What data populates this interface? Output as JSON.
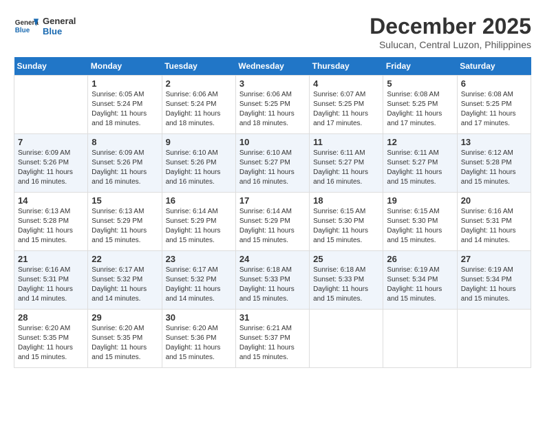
{
  "logo": {
    "text_general": "General",
    "text_blue": "Blue"
  },
  "title": "December 2025",
  "location": "Sulucan, Central Luzon, Philippines",
  "days_of_week": [
    "Sunday",
    "Monday",
    "Tuesday",
    "Wednesday",
    "Thursday",
    "Friday",
    "Saturday"
  ],
  "weeks": [
    [
      {
        "day": "",
        "sunrise": "",
        "sunset": "",
        "daylight": ""
      },
      {
        "day": "1",
        "sunrise": "6:05 AM",
        "sunset": "5:24 PM",
        "daylight": "11 hours and 18 minutes."
      },
      {
        "day": "2",
        "sunrise": "6:06 AM",
        "sunset": "5:24 PM",
        "daylight": "11 hours and 18 minutes."
      },
      {
        "day": "3",
        "sunrise": "6:06 AM",
        "sunset": "5:25 PM",
        "daylight": "11 hours and 18 minutes."
      },
      {
        "day": "4",
        "sunrise": "6:07 AM",
        "sunset": "5:25 PM",
        "daylight": "11 hours and 17 minutes."
      },
      {
        "day": "5",
        "sunrise": "6:08 AM",
        "sunset": "5:25 PM",
        "daylight": "11 hours and 17 minutes."
      },
      {
        "day": "6",
        "sunrise": "6:08 AM",
        "sunset": "5:25 PM",
        "daylight": "11 hours and 17 minutes."
      }
    ],
    [
      {
        "day": "7",
        "sunrise": "6:09 AM",
        "sunset": "5:26 PM",
        "daylight": "11 hours and 16 minutes."
      },
      {
        "day": "8",
        "sunrise": "6:09 AM",
        "sunset": "5:26 PM",
        "daylight": "11 hours and 16 minutes."
      },
      {
        "day": "9",
        "sunrise": "6:10 AM",
        "sunset": "5:26 PM",
        "daylight": "11 hours and 16 minutes."
      },
      {
        "day": "10",
        "sunrise": "6:10 AM",
        "sunset": "5:27 PM",
        "daylight": "11 hours and 16 minutes."
      },
      {
        "day": "11",
        "sunrise": "6:11 AM",
        "sunset": "5:27 PM",
        "daylight": "11 hours and 16 minutes."
      },
      {
        "day": "12",
        "sunrise": "6:11 AM",
        "sunset": "5:27 PM",
        "daylight": "11 hours and 15 minutes."
      },
      {
        "day": "13",
        "sunrise": "6:12 AM",
        "sunset": "5:28 PM",
        "daylight": "11 hours and 15 minutes."
      }
    ],
    [
      {
        "day": "14",
        "sunrise": "6:13 AM",
        "sunset": "5:28 PM",
        "daylight": "11 hours and 15 minutes."
      },
      {
        "day": "15",
        "sunrise": "6:13 AM",
        "sunset": "5:29 PM",
        "daylight": "11 hours and 15 minutes."
      },
      {
        "day": "16",
        "sunrise": "6:14 AM",
        "sunset": "5:29 PM",
        "daylight": "11 hours and 15 minutes."
      },
      {
        "day": "17",
        "sunrise": "6:14 AM",
        "sunset": "5:29 PM",
        "daylight": "11 hours and 15 minutes."
      },
      {
        "day": "18",
        "sunrise": "6:15 AM",
        "sunset": "5:30 PM",
        "daylight": "11 hours and 15 minutes."
      },
      {
        "day": "19",
        "sunrise": "6:15 AM",
        "sunset": "5:30 PM",
        "daylight": "11 hours and 15 minutes."
      },
      {
        "day": "20",
        "sunrise": "6:16 AM",
        "sunset": "5:31 PM",
        "daylight": "11 hours and 14 minutes."
      }
    ],
    [
      {
        "day": "21",
        "sunrise": "6:16 AM",
        "sunset": "5:31 PM",
        "daylight": "11 hours and 14 minutes."
      },
      {
        "day": "22",
        "sunrise": "6:17 AM",
        "sunset": "5:32 PM",
        "daylight": "11 hours and 14 minutes."
      },
      {
        "day": "23",
        "sunrise": "6:17 AM",
        "sunset": "5:32 PM",
        "daylight": "11 hours and 14 minutes."
      },
      {
        "day": "24",
        "sunrise": "6:18 AM",
        "sunset": "5:33 PM",
        "daylight": "11 hours and 15 minutes."
      },
      {
        "day": "25",
        "sunrise": "6:18 AM",
        "sunset": "5:33 PM",
        "daylight": "11 hours and 15 minutes."
      },
      {
        "day": "26",
        "sunrise": "6:19 AM",
        "sunset": "5:34 PM",
        "daylight": "11 hours and 15 minutes."
      },
      {
        "day": "27",
        "sunrise": "6:19 AM",
        "sunset": "5:34 PM",
        "daylight": "11 hours and 15 minutes."
      }
    ],
    [
      {
        "day": "28",
        "sunrise": "6:20 AM",
        "sunset": "5:35 PM",
        "daylight": "11 hours and 15 minutes."
      },
      {
        "day": "29",
        "sunrise": "6:20 AM",
        "sunset": "5:35 PM",
        "daylight": "11 hours and 15 minutes."
      },
      {
        "day": "30",
        "sunrise": "6:20 AM",
        "sunset": "5:36 PM",
        "daylight": "11 hours and 15 minutes."
      },
      {
        "day": "31",
        "sunrise": "6:21 AM",
        "sunset": "5:37 PM",
        "daylight": "11 hours and 15 minutes."
      },
      {
        "day": "",
        "sunrise": "",
        "sunset": "",
        "daylight": ""
      },
      {
        "day": "",
        "sunrise": "",
        "sunset": "",
        "daylight": ""
      },
      {
        "day": "",
        "sunrise": "",
        "sunset": "",
        "daylight": ""
      }
    ]
  ],
  "labels": {
    "sunrise_prefix": "Sunrise: ",
    "sunset_prefix": "Sunset: ",
    "daylight_prefix": "Daylight: "
  }
}
